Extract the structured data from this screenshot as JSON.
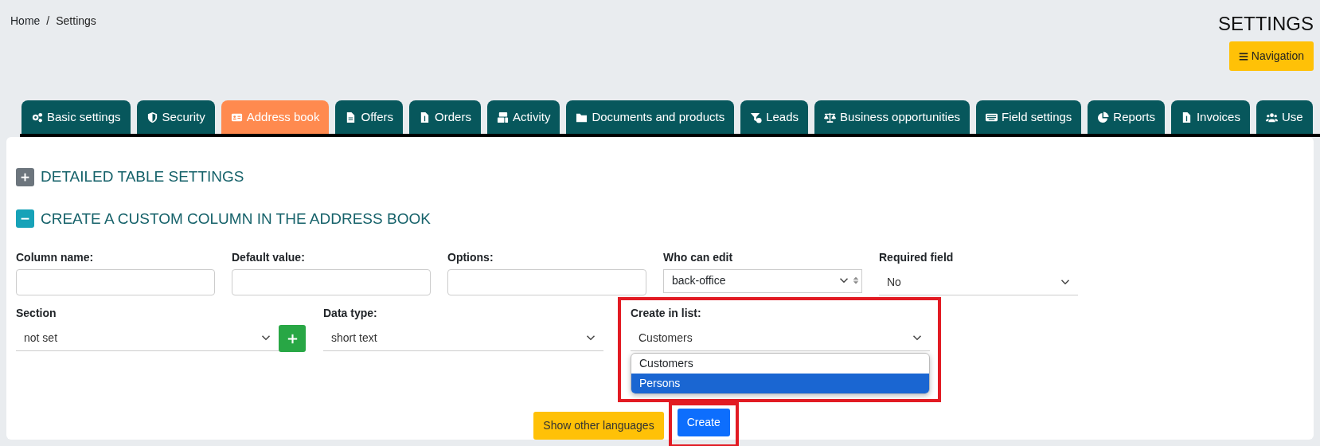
{
  "breadcrumb": {
    "separator": "/",
    "items": [
      {
        "label": "Home"
      },
      {
        "label": "Settings"
      }
    ]
  },
  "page_title": "SETTINGS",
  "nav_button": {
    "label": "Navigation"
  },
  "tabs": [
    {
      "label": "Basic settings",
      "selected": false
    },
    {
      "label": "Security",
      "selected": false
    },
    {
      "label": "Address book",
      "selected": true
    },
    {
      "label": "Offers",
      "selected": false
    },
    {
      "label": "Orders",
      "selected": false
    },
    {
      "label": "Activity",
      "selected": false
    },
    {
      "label": "Documents and products",
      "selected": false
    },
    {
      "label": "Leads",
      "selected": false
    },
    {
      "label": "Business opportunities",
      "selected": false
    },
    {
      "label": "Field settings",
      "selected": false
    },
    {
      "label": "Reports",
      "selected": false
    },
    {
      "label": "Invoices",
      "selected": false
    },
    {
      "label": "Use",
      "selected": false
    }
  ],
  "sections": [
    {
      "title": "DETAILED TABLE SETTINGS",
      "expanded": false
    },
    {
      "title": "CREATE A CUSTOM COLUMN IN THE ADDRESS BOOK",
      "expanded": true
    }
  ],
  "form": {
    "row_1": [
      {
        "kind": "text",
        "label": "Column name:"
      },
      {
        "kind": "text",
        "label": "Default value:"
      },
      {
        "kind": "text",
        "label": "Options:"
      },
      {
        "kind": "listbox",
        "label": "Who can edit",
        "value": "back-office"
      },
      {
        "kind": "select",
        "label": "Required field",
        "value": "No"
      }
    ],
    "row_2": [
      {
        "kind": "select_add",
        "label": "Section",
        "value": "not set"
      },
      {
        "kind": "select",
        "label": "Data type:",
        "value": "short text"
      },
      {
        "kind": "select",
        "label": "Create in list:",
        "value": "Customers",
        "highlighted": true,
        "options": [
          {
            "label": "Customers",
            "highlighted": false
          },
          {
            "label": "Persons",
            "highlighted": true
          }
        ]
      }
    ]
  },
  "buttons": [
    {
      "kind": "warning",
      "label": "Show other languages",
      "highlighted": false
    },
    {
      "kind": "primary",
      "label": "Create",
      "highlighted": true
    }
  ]
}
